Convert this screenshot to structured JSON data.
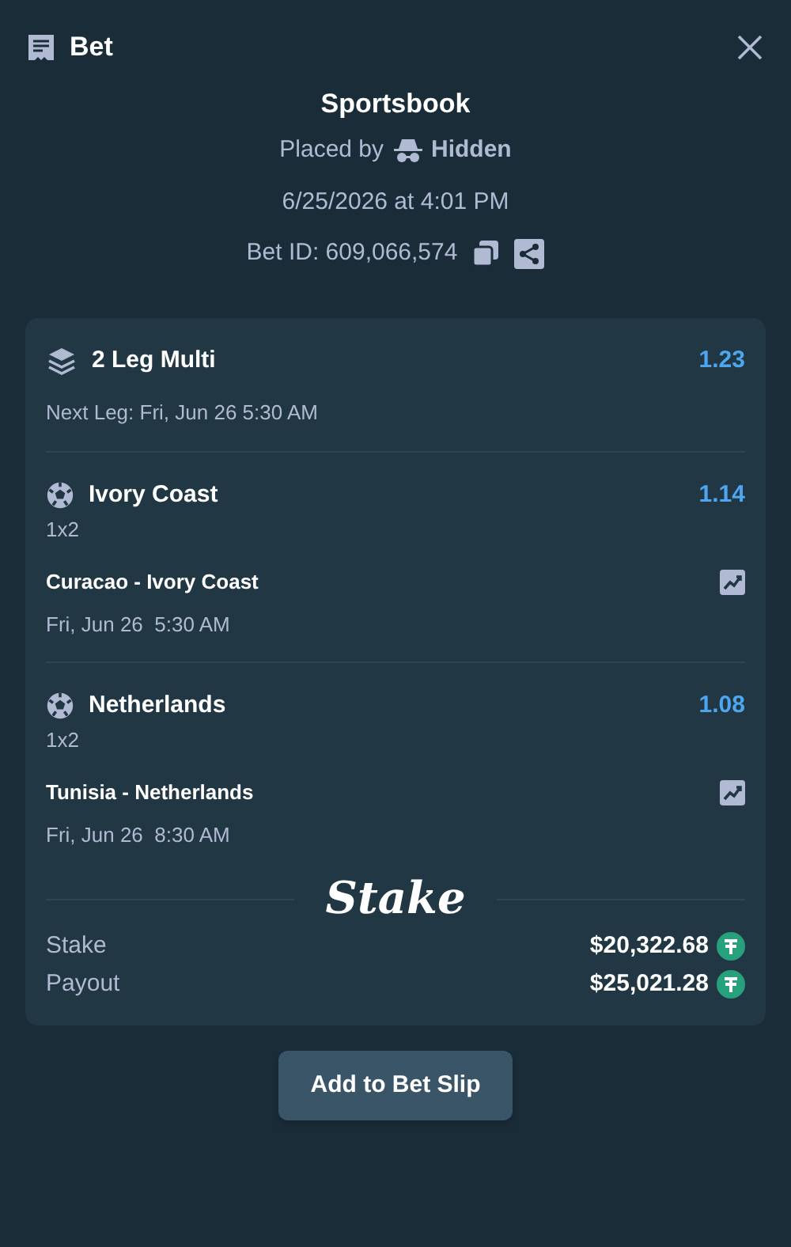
{
  "header": {
    "title": "Bet"
  },
  "summary": {
    "title": "Sportsbook",
    "placed_by_label": "Placed by",
    "placed_by_user": "Hidden",
    "datetime": "6/25/2026 at 4:01 PM",
    "bet_id": "Bet ID: 609,066,574"
  },
  "multi": {
    "title": "2 Leg Multi",
    "odds": "1.23",
    "next_leg": "Next Leg: Fri, Jun 26 5:30 AM"
  },
  "legs": [
    {
      "selection": "Ivory Coast",
      "odds": "1.14",
      "market": "1x2",
      "match": "Curacao - Ivory Coast",
      "time": "Fri, Jun 26  5:30 AM"
    },
    {
      "selection": "Netherlands",
      "odds": "1.08",
      "market": "1x2",
      "match": "Tunisia - Netherlands",
      "time": "Fri, Jun 26  8:30 AM"
    }
  ],
  "brand": "Stake",
  "totals": [
    {
      "label": "Stake",
      "amount": "$20,322.68"
    },
    {
      "label": "Payout",
      "amount": "$25,021.28"
    }
  ],
  "button": "Add to Bet Slip"
}
